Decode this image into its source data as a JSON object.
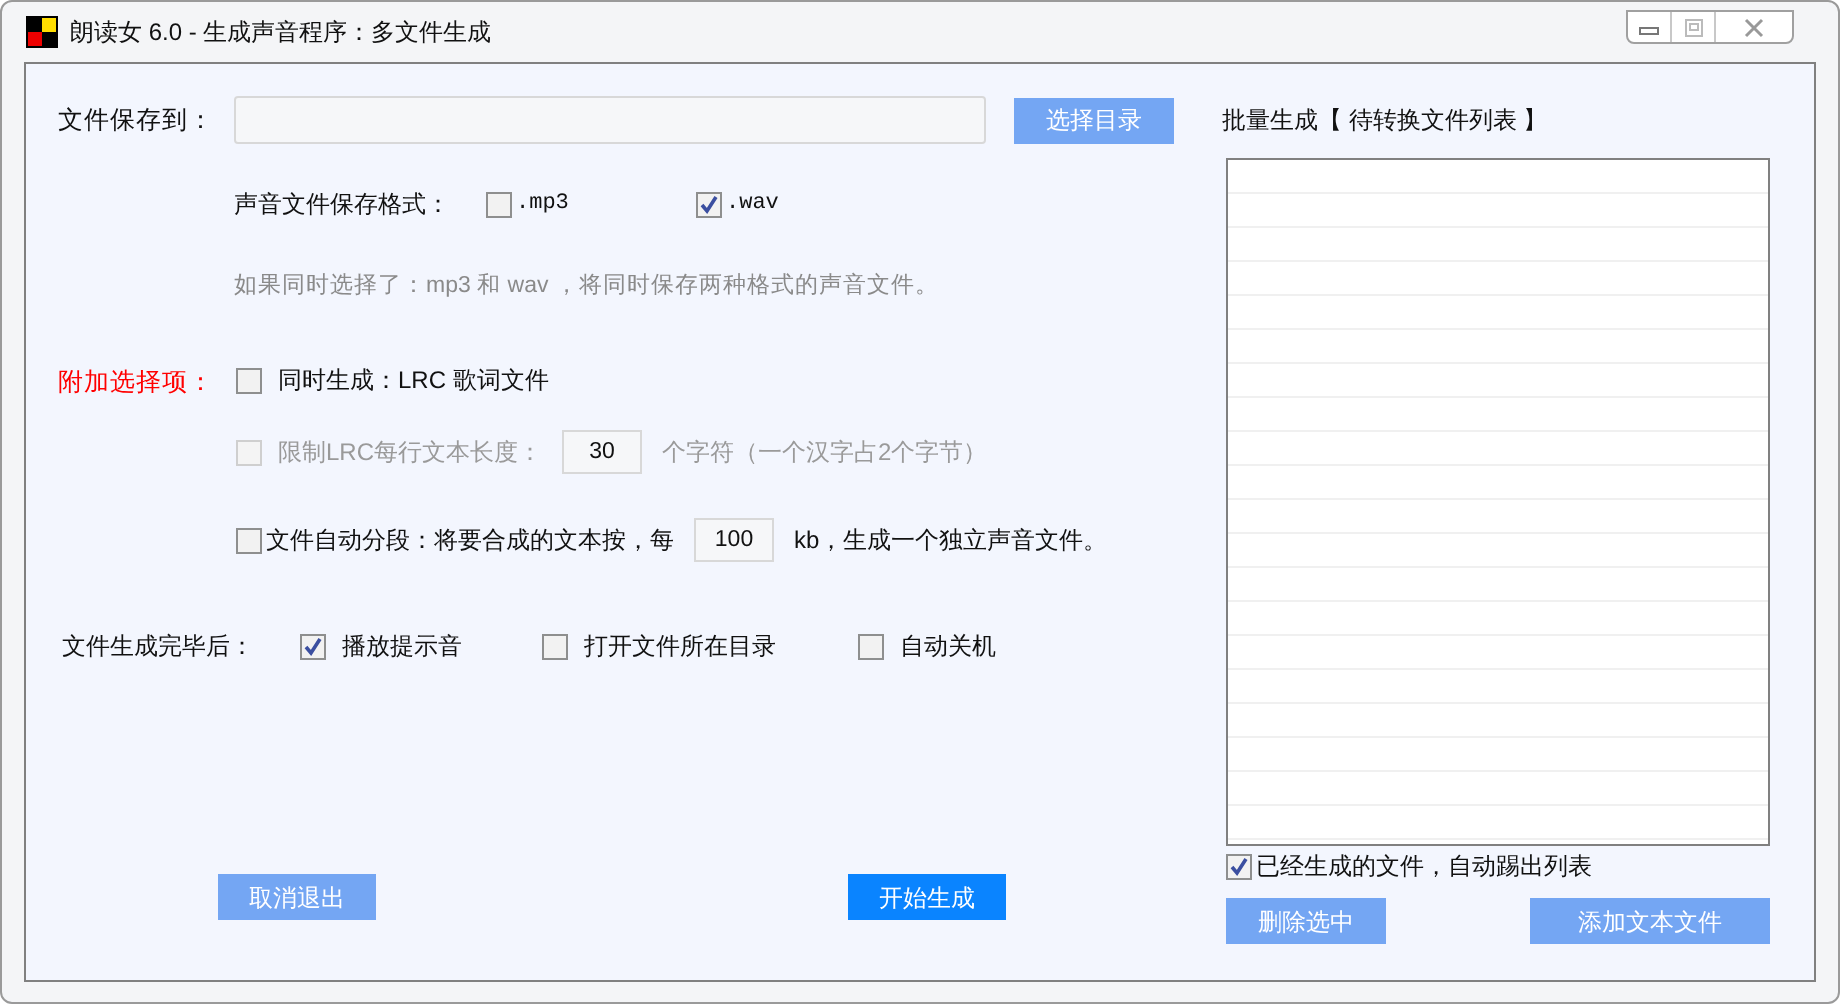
{
  "window": {
    "title": "朗读女 6.0 - 生成声音程序：多文件生成"
  },
  "save_to": {
    "label": "文件保存到：",
    "button": "选择目录"
  },
  "format": {
    "label": "声音文件保存格式：",
    "options": [
      {
        "label": ".mp3",
        "checked": false
      },
      {
        "label": ".wav",
        "checked": true
      }
    ]
  },
  "hint": "如果同时选择了：mp3 和 wav ，将同时保存两种格式的声音文件。",
  "extras": {
    "label": "附加选择项：",
    "options": [
      {
        "kind": "plain",
        "label": "同时生成：LRC 歌词文件",
        "checked": false,
        "disabled": false
      },
      {
        "kind": "number",
        "label": "限制LRC每行文本长度：",
        "value": "30",
        "suffix": "个字符（一个汉字占2个字节）",
        "checked": false,
        "disabled": true
      },
      {
        "kind": "number",
        "label": "文件自动分段：将要合成的文本按，每",
        "value": "100",
        "suffix": "kb，生成一个独立声音文件。",
        "checked": false,
        "disabled": false
      }
    ]
  },
  "after": {
    "label": "文件生成完毕后：",
    "options": [
      {
        "label": "播放提示音",
        "checked": true
      },
      {
        "label": "打开文件所在目录",
        "checked": false
      },
      {
        "label": "自动关机",
        "checked": false
      }
    ]
  },
  "buttons": [
    {
      "label": "取消退出",
      "kind": "secondary"
    },
    {
      "label": "开始生成",
      "kind": "primary"
    }
  ],
  "batch": {
    "title": "批量生成【 待转换文件列表 】",
    "auto_remove": {
      "label": "已经生成的文件，自动踢出列表",
      "checked": true
    },
    "buttons": [
      {
        "label": "删除选中",
        "kind": "secondary"
      },
      {
        "label": "添加文本文件",
        "kind": "secondary"
      }
    ]
  }
}
